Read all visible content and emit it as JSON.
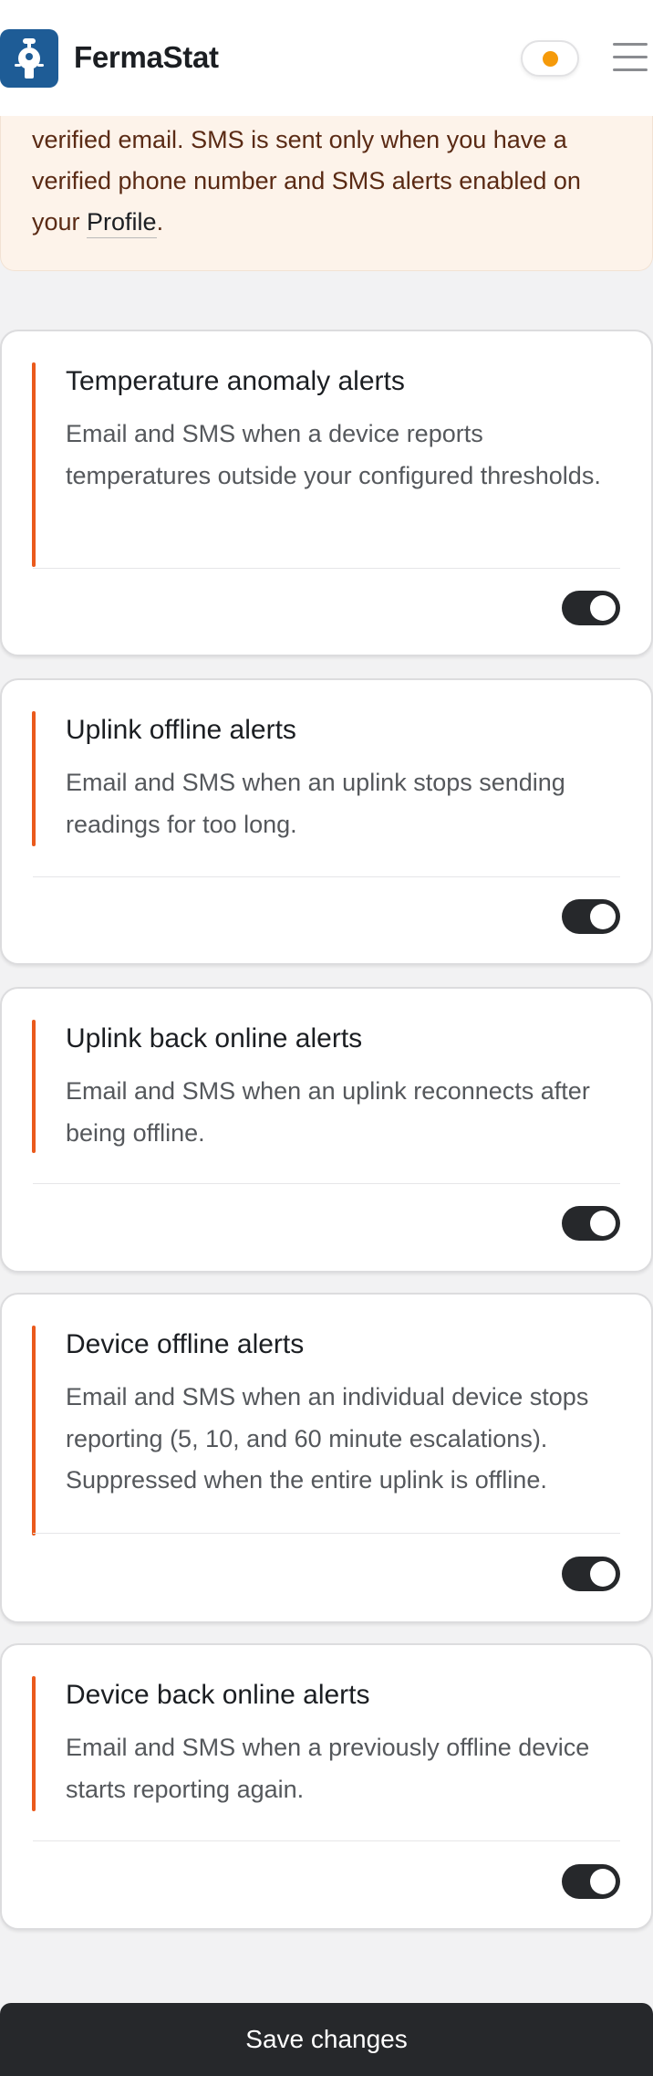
{
  "header": {
    "brand": "FermaStat",
    "logo_icon": "robot-thermometer-icon",
    "theme_toggle_icon": "sun-icon",
    "menu_icon": "hamburger-menu-icon",
    "colors": {
      "logo_bg": "#1e5c96",
      "sun": "#f59a0a"
    }
  },
  "notice": {
    "text_before": "verified email. SMS is sent only when you have a verified phone number and SMS alerts enabled on your ",
    "link_label": "Profile",
    "text_after": "."
  },
  "alerts": [
    {
      "title": "Temperature anomaly alerts",
      "description": "Email and SMS when a device reports temperatures outside your configured thresholds.",
      "enabled": true
    },
    {
      "title": "Uplink offline alerts",
      "description": "Email and SMS when an uplink stops sending readings for too long.",
      "enabled": true
    },
    {
      "title": "Uplink back online alerts",
      "description": "Email and SMS when an uplink reconnects after being offline.",
      "enabled": true
    },
    {
      "title": "Device offline alerts",
      "description": "Email and SMS when an individual device stops reporting (5, 10, and 60 minute escalations). Suppressed when the entire uplink is offline.",
      "enabled": true
    },
    {
      "title": "Device back online alerts",
      "description": "Email and SMS when a previously offline device starts reporting again.",
      "enabled": true
    }
  ],
  "save_label": "Save changes",
  "colors": {
    "accent": "#ea5a1c",
    "toggle_on": "#26282b",
    "notice_bg": "#fdf3ea"
  }
}
